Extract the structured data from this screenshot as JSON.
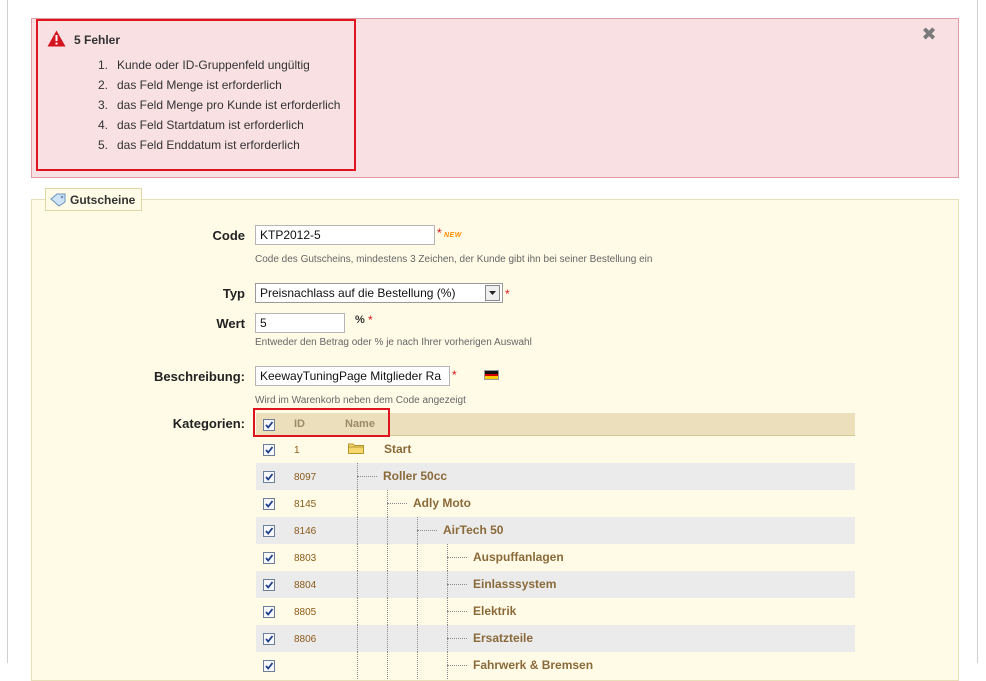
{
  "errors": {
    "title": "5 Fehler",
    "items": [
      {
        "num": "1.",
        "text": "Kunde oder ID-Gruppenfeld ungültig"
      },
      {
        "num": "2.",
        "text": "das Feld Menge ist erforderlich"
      },
      {
        "num": "3.",
        "text": "das Feld Menge pro Kunde ist erforderlich"
      },
      {
        "num": "4.",
        "text": "das Feld Startdatum ist erforderlich"
      },
      {
        "num": "5.",
        "text": "das Feld Enddatum ist erforderlich"
      }
    ],
    "close_symbol": "✖",
    "colors": {
      "background": "#f8e0e3",
      "highlight": "#e0141e"
    }
  },
  "panel": {
    "legend": "Gutscheine"
  },
  "form": {
    "code": {
      "label": "Code",
      "value": "KTP2012-5",
      "required": "*",
      "badge": "NEW",
      "hint": "Code des Gutscheins, mindestens 3 Zeichen, der Kunde gibt ihn bei seiner Bestellung ein"
    },
    "typ": {
      "label": "Typ",
      "value": "Preisnachlass auf die Bestellung (%)",
      "required": "*"
    },
    "wert": {
      "label": "Wert",
      "value": "5",
      "unit": "%",
      "required": "*",
      "hint": "Entweder den Betrag oder % je nach Ihrer vorherigen Auswahl"
    },
    "beschreibung": {
      "label": "Beschreibung:",
      "value": "KeewayTuningPage Mitglieder Ra",
      "required": "*",
      "hint": "Wird im Warenkorb neben dem Code angezeigt"
    },
    "kategorien": {
      "label": "Kategorien:"
    }
  },
  "categories": {
    "headers": {
      "id": "ID",
      "name": "Name"
    },
    "rows": [
      {
        "id": "1",
        "name": "Start",
        "checked": true
      },
      {
        "id": "8097",
        "name": "Roller 50cc",
        "checked": true
      },
      {
        "id": "8145",
        "name": "Adly Moto",
        "checked": true
      },
      {
        "id": "8146",
        "name": "AirTech 50",
        "checked": true
      },
      {
        "id": "8803",
        "name": "Auspuffanlagen",
        "checked": true
      },
      {
        "id": "8804",
        "name": "Einlasssystem",
        "checked": true
      },
      {
        "id": "8805",
        "name": "Elektrik",
        "checked": true
      },
      {
        "id": "8806",
        "name": "Ersatzteile",
        "checked": true
      },
      {
        "id": "",
        "name": "Fahrwerk & Bremsen",
        "checked": true
      }
    ]
  }
}
